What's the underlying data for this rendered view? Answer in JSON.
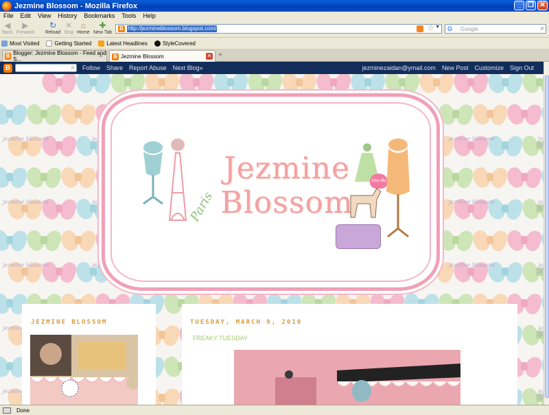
{
  "window": {
    "title": "Jezmine Blossom - Mozilla Firefox"
  },
  "menu": [
    "File",
    "Edit",
    "View",
    "History",
    "Bookmarks",
    "Tools",
    "Help"
  ],
  "nav": {
    "back": "Back",
    "forward": "Forward",
    "reload": "Reload",
    "stop": "Stop",
    "home": "Home",
    "new_tab": "New Tab"
  },
  "url": "http://jezmineblossom.blogspot.com/",
  "search": {
    "placeholder": "Google"
  },
  "bookmarks": [
    "Most Visited",
    "Getting Started",
    "Latest Headlines",
    "StyleCovered"
  ],
  "tabs": [
    {
      "label": "Blogger: Jezmine Blossom - Feed and S...",
      "active": false
    },
    {
      "label": "Jezmine Blossom",
      "active": true
    }
  ],
  "blogger": {
    "links": [
      "Follow",
      "Share",
      "Report Abuse",
      "Next Blog»"
    ],
    "user": "jezminezaidan@ymail.com",
    "right": [
      "New Post",
      "Customize",
      "Sign Out"
    ]
  },
  "header": {
    "title_line1": "Jezmine",
    "title_line2": "Blossom",
    "paris": "Paris",
    "kiss": "Kiss Me",
    "watermark": "jezmine blossom"
  },
  "sidebar": {
    "heading": "JEZMINE BLOSSOM"
  },
  "post": {
    "date": "TUESDAY, MARCH 9, 2010",
    "title": "FREAKY TUESDAY"
  },
  "status": {
    "text": "Done"
  },
  "colors": {
    "bloggerbar": "#132d5b",
    "accent": "#d99b3b",
    "frame": "#f1a0b6"
  }
}
